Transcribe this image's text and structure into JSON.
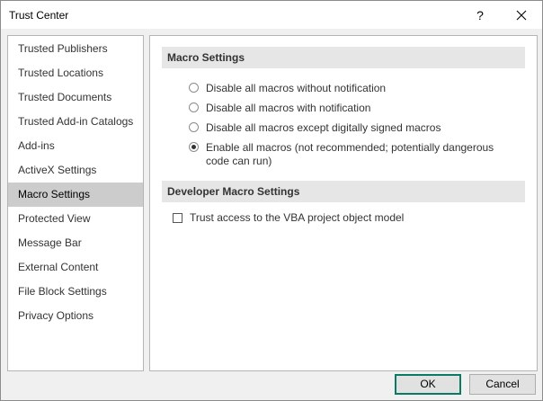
{
  "window": {
    "title": "Trust Center",
    "help_label": "?"
  },
  "sidebar": {
    "items": [
      {
        "label": "Trusted Publishers",
        "selected": false
      },
      {
        "label": "Trusted Locations",
        "selected": false
      },
      {
        "label": "Trusted Documents",
        "selected": false
      },
      {
        "label": "Trusted Add-in Catalogs",
        "selected": false
      },
      {
        "label": "Add-ins",
        "selected": false
      },
      {
        "label": "ActiveX Settings",
        "selected": false
      },
      {
        "label": "Macro Settings",
        "selected": true
      },
      {
        "label": "Protected View",
        "selected": false
      },
      {
        "label": "Message Bar",
        "selected": false
      },
      {
        "label": "External Content",
        "selected": false
      },
      {
        "label": "File Block Settings",
        "selected": false
      },
      {
        "label": "Privacy Options",
        "selected": false
      }
    ]
  },
  "macro_settings": {
    "header": "Macro Settings",
    "options": [
      {
        "label": "Disable all macros without notification",
        "checked": false
      },
      {
        "label": "Disable all macros with notification",
        "checked": false
      },
      {
        "label": "Disable all macros except digitally signed macros",
        "checked": false
      },
      {
        "label": "Enable all macros (not recommended; potentially dangerous code can run)",
        "checked": true
      }
    ]
  },
  "developer_settings": {
    "header": "Developer Macro Settings",
    "vba_label": "Trust access to the VBA project object model",
    "vba_checked": false
  },
  "buttons": {
    "ok": "OK",
    "cancel": "Cancel"
  },
  "colors": {
    "selected_nav": "#cccccc",
    "section_header": "#e6e6e6",
    "default_button_border": "#0a7a65"
  }
}
